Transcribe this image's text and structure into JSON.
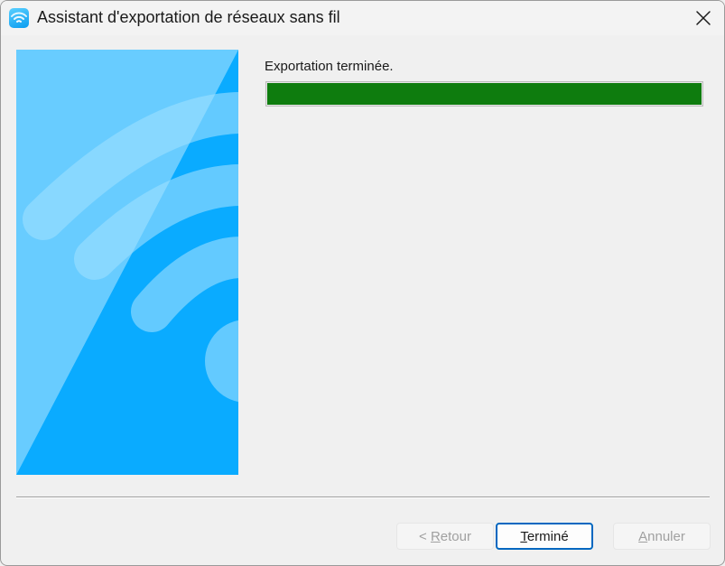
{
  "window": {
    "title": "Assistant d'exportation de réseaux sans fil",
    "icon": "wifi-app-icon",
    "close_icon": "close-icon"
  },
  "side_panel": {
    "image": "wifi-signal-illustration",
    "colors": {
      "background": "#0AABFF",
      "light": "#66CCFF",
      "arc": "#8FDAFF"
    }
  },
  "status": {
    "label": "Exportation terminée.",
    "progress": 1.0,
    "progress_color": "#0E7C0E"
  },
  "buttons": {
    "back": {
      "label": "< Retour",
      "mnemonic": "R",
      "enabled": false
    },
    "finish": {
      "label": "Terminé",
      "mnemonic": "T",
      "enabled": true,
      "default": true
    },
    "cancel": {
      "label": "Annuler",
      "mnemonic": "A",
      "enabled": false
    }
  },
  "colors": {
    "accent": "#0067C0",
    "window_bg": "#F0F0F0"
  }
}
